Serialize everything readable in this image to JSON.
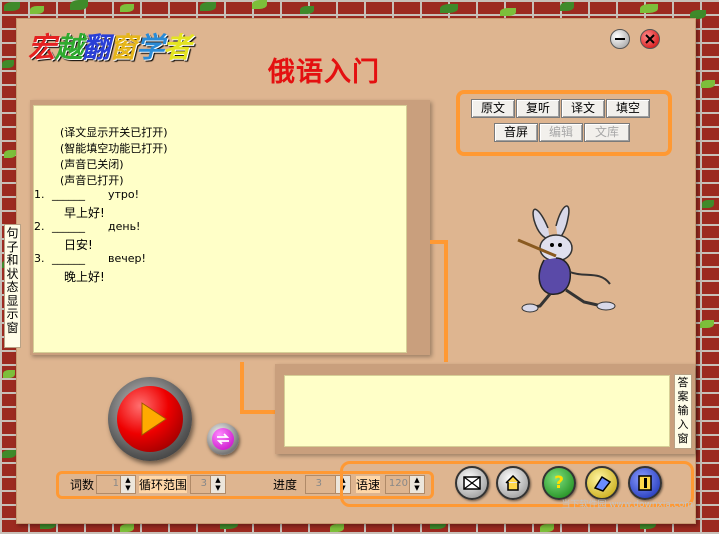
{
  "app": {
    "logo_chars": [
      "宏",
      "越",
      "翻",
      "窗",
      "学",
      "者"
    ],
    "title": "俄语入门"
  },
  "window_controls": {
    "minimize_icon": "minimize-icon",
    "close_icon": "close-icon"
  },
  "sentence_panel": {
    "label": "句子和状态显示窗",
    "status_lines": [
      "(译文显示开关已打开)",
      "(智能填空功能已打开)",
      "(声音已关闭)",
      "(声音已打开)"
    ],
    "items": [
      {
        "num": "1.",
        "blank": "______",
        "ru": "утро!",
        "zh": "早上好!"
      },
      {
        "num": "2.",
        "blank": "______",
        "ru": "день!",
        "zh": "日安!"
      },
      {
        "num": "3.",
        "blank": "______",
        "ru": "вечер!",
        "zh": "晚上好!"
      }
    ]
  },
  "toolbar": {
    "row1": [
      "原文",
      "复听",
      "译文",
      "填空"
    ],
    "row2": [
      {
        "label": "音屏",
        "enabled": true
      },
      {
        "label": "编辑",
        "enabled": false
      },
      {
        "label": "文库",
        "enabled": false
      }
    ]
  },
  "answer_panel": {
    "label": "答案输入窗",
    "value": ""
  },
  "controls": {
    "word_count": {
      "label": "词数",
      "value": "1"
    },
    "loop_range": {
      "label": "循环范围",
      "value": "3"
    },
    "progress": {
      "label": "进度",
      "value": "3"
    },
    "speed": {
      "label": "语速",
      "value": "120"
    }
  },
  "icons": {
    "play": "play-icon",
    "loop": "loop-icon",
    "mail": "mail-icon",
    "home": "home-icon",
    "help": "help-icon",
    "book": "book-icon",
    "exit": "exit-icon"
  },
  "watermark": "当下软件园 www.downxia.com",
  "colors": {
    "accent": "#ff9933",
    "panel": "#deb590",
    "text_area": "#ffffc8",
    "title": "#e41010"
  }
}
